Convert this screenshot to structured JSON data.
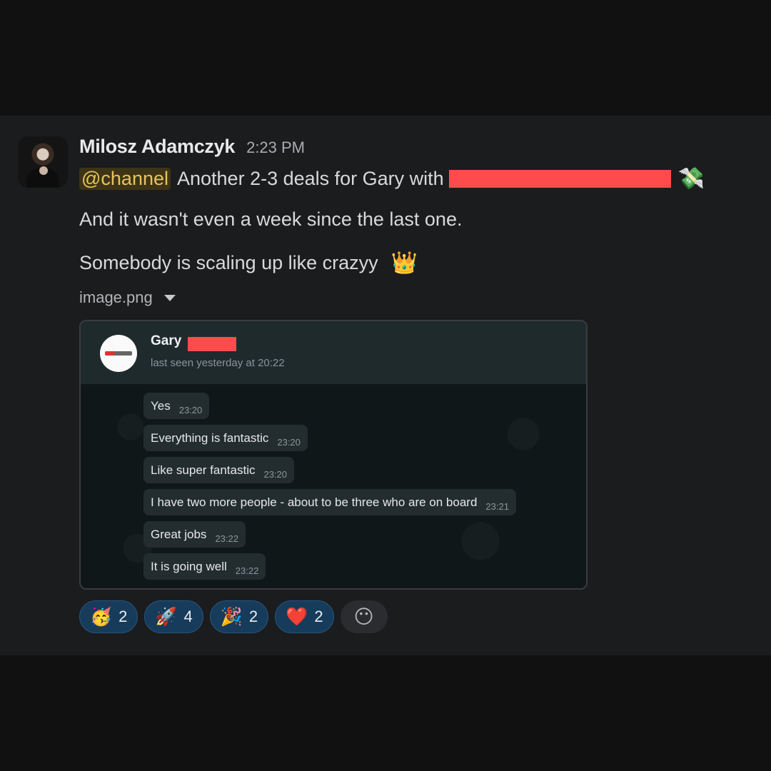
{
  "message": {
    "author": "Milosz Adamczyk",
    "time": "2:23 PM",
    "mention": "@channel",
    "line1_text": "Another 2-3 deals for Gary with",
    "line1_emoji": "💸",
    "line2_text": "And it wasn't even a week since the last one.",
    "line3_text": "Somebody is scaling up like crazyy",
    "line3_emoji": "👑"
  },
  "attachment": {
    "filename": "image.png"
  },
  "screenshot": {
    "contact_name": "Gary",
    "status": "last seen yesterday at 20:22",
    "messages": [
      {
        "text": "Yes",
        "time": "23:20"
      },
      {
        "text": "Everything is fantastic",
        "time": "23:20"
      },
      {
        "text": "Like super fantastic",
        "time": "23:20"
      },
      {
        "text": "I have two more people - about to be three who are on board",
        "time": "23:21"
      },
      {
        "text": "Great jobs",
        "time": "23:22"
      },
      {
        "text": "It is going well",
        "time": "23:22"
      }
    ]
  },
  "reactions": [
    {
      "emoji": "🥳",
      "count": "2",
      "icon": "partying-face-icon"
    },
    {
      "emoji": "🚀",
      "count": "4",
      "icon": "rocket-icon"
    },
    {
      "emoji": "🎉",
      "count": "2",
      "icon": "party-popper-icon"
    },
    {
      "emoji": "❤️",
      "count": "2",
      "icon": "red-heart-icon"
    }
  ],
  "add_reaction_icon": "😶",
  "colors": {
    "mention_bg": "#3d3418",
    "mention_text": "#e8c35a",
    "reaction_bg": "#173b5a",
    "redaction": "#ff4b4b"
  }
}
